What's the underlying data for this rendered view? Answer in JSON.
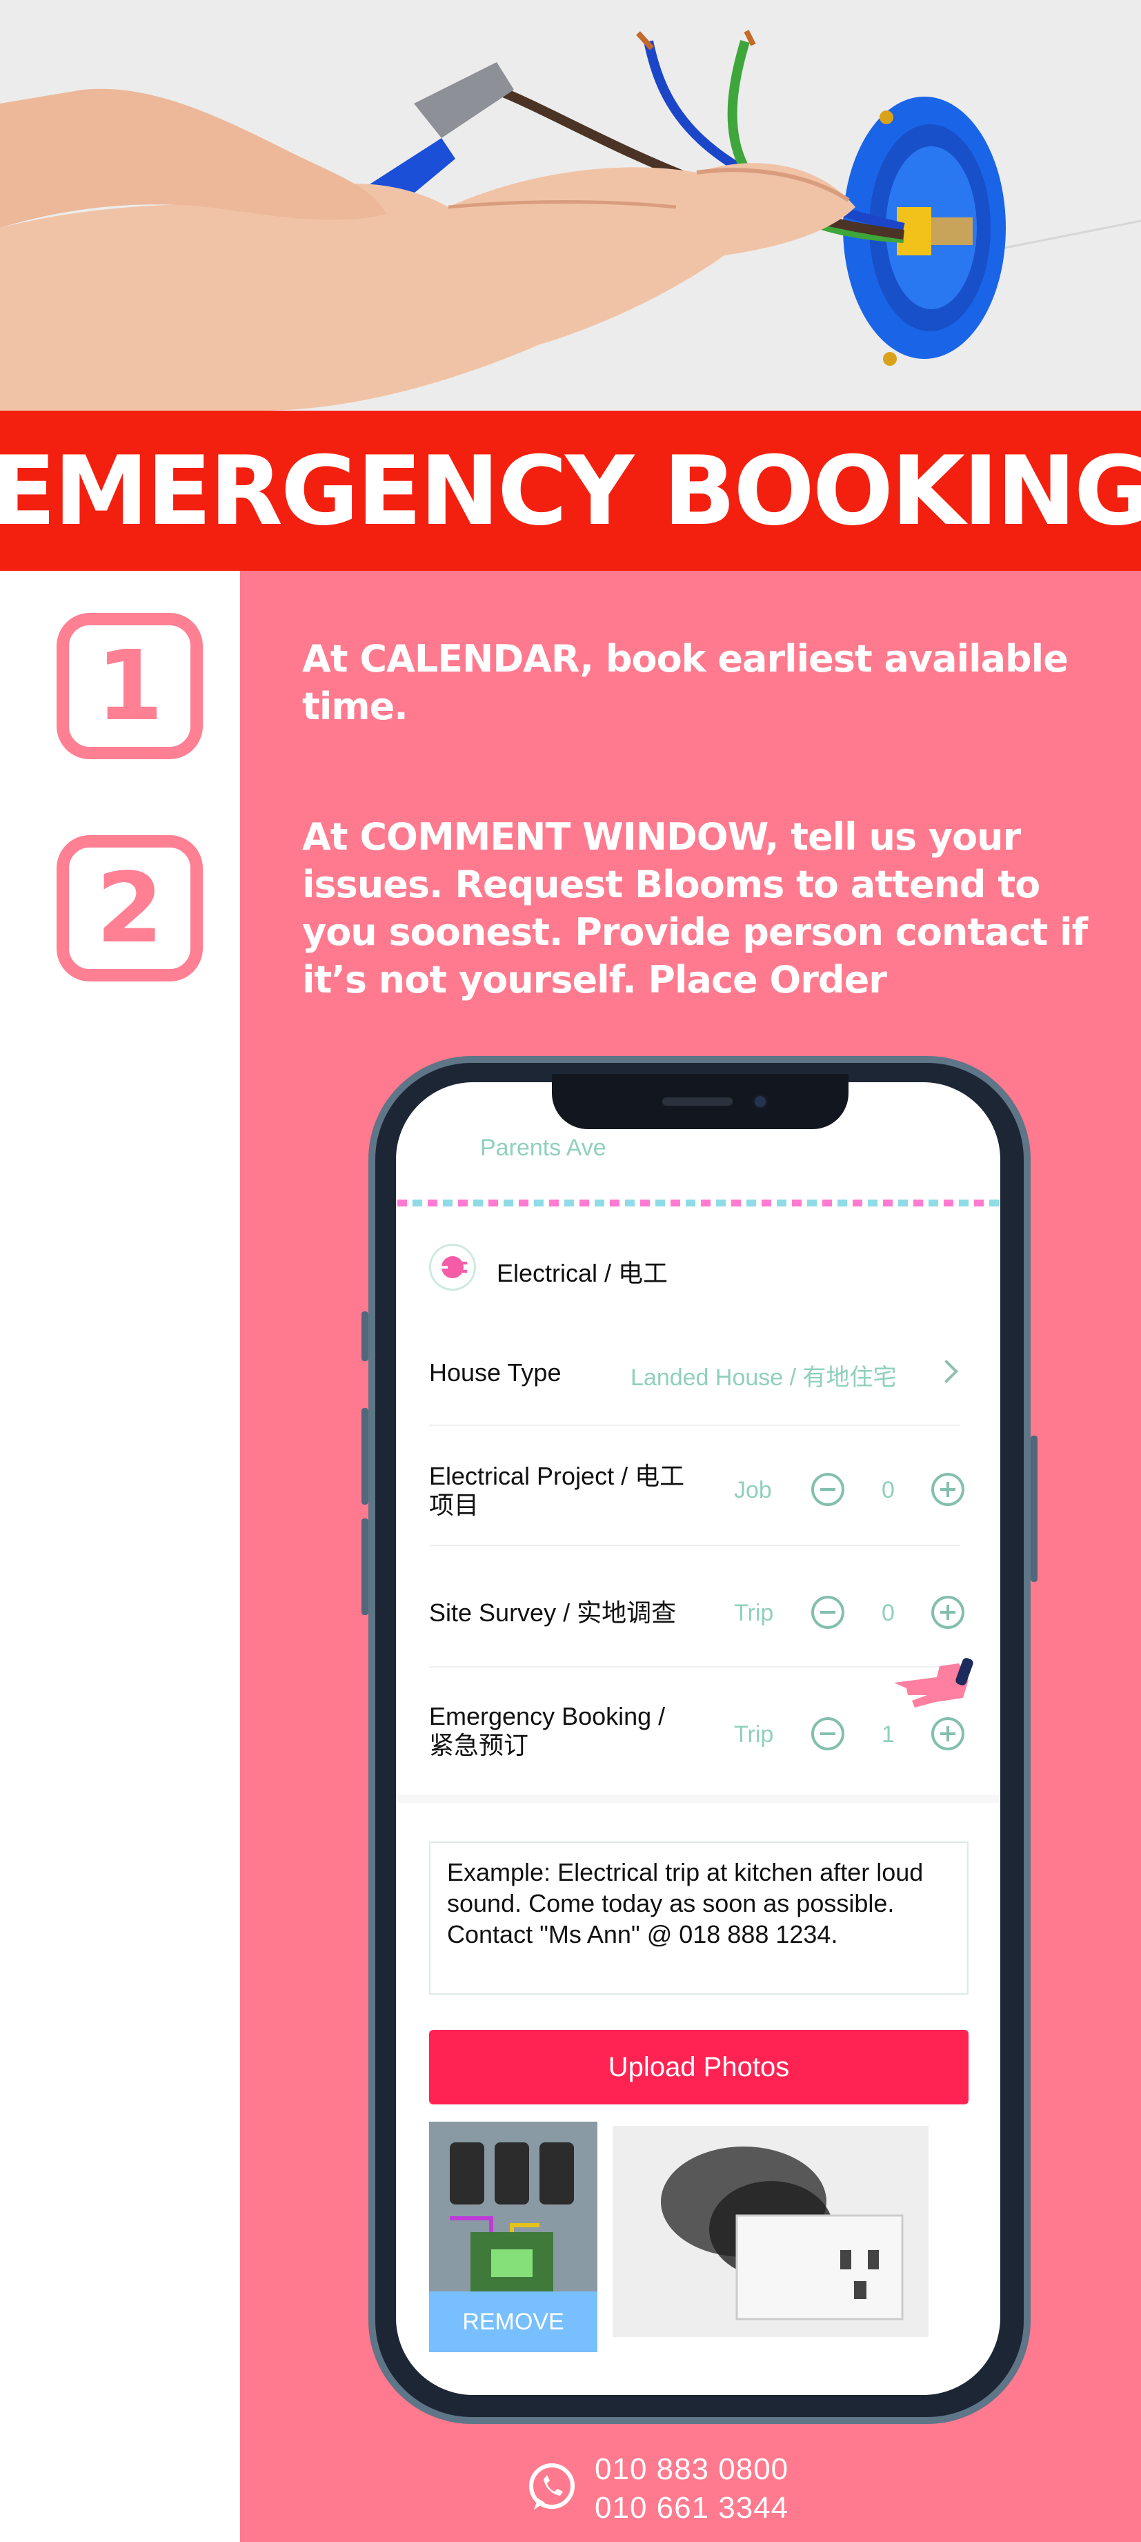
{
  "banner": {
    "title": "EMERGENCY BOOKING"
  },
  "steps": [
    {
      "number": "1",
      "text": "At CALENDAR, book earliest available time."
    },
    {
      "number": "2",
      "text": "At COMMENT WINDOW, tell us your issues. Request Blooms to attend to you soonest. Provide person contact if it’s not yourself.  Place Order"
    }
  ],
  "phone": {
    "address_fragment": "Parents Ave",
    "service": {
      "icon": "plug-icon",
      "label": "Electrical / 电工"
    },
    "house_type": {
      "label": "House Type",
      "value": "Landed House / 有地住宅",
      "icon": "chevron-right-icon"
    },
    "items": [
      {
        "label_line1": "Electrical Project / 电工",
        "label_line2": "项目",
        "unit": "Job",
        "qty": "0"
      },
      {
        "label_line1": "Site Survey / 实地调查",
        "label_line2": "",
        "unit": "Trip",
        "qty": "0"
      },
      {
        "label_line1": "Emergency Booking /",
        "label_line2": "紧急预订",
        "unit": "Trip",
        "qty": "1"
      }
    ],
    "comment": "Example: Electrical trip at kitchen after loud sound. Come today as soon as possible. Contact \"Ms Ann\" @ 018 888 1234.",
    "upload_label": "Upload Photos",
    "remove_label": "REMOVE"
  },
  "contact": {
    "icon": "whatsapp-icon",
    "phone1": "010 883 0800",
    "phone2": "010 661 3344"
  },
  "colors": {
    "banner_red": "#f4200f",
    "pink_bg": "#ff7a8e",
    "badge_pink": "#ff7f93",
    "teal": "#8fd0bd",
    "upload_red": "#ff2353",
    "remove_blue": "#78bfff"
  }
}
